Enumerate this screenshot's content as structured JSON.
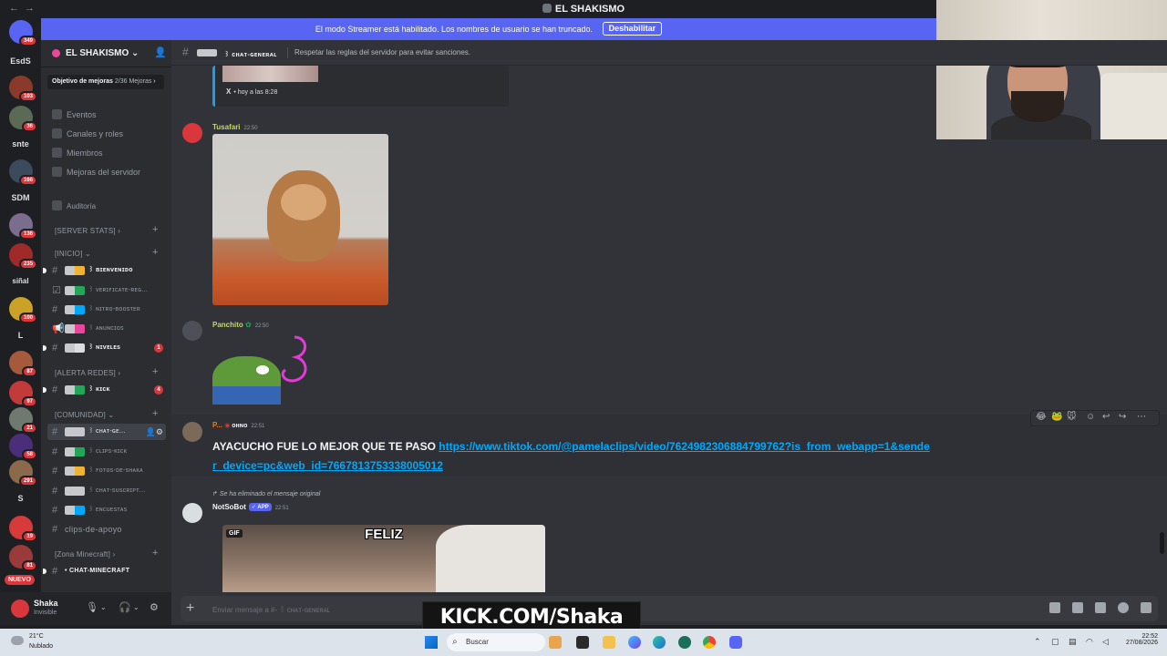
{
  "window": {
    "title": "EL SHAKISMO",
    "back": "←",
    "forward": "→"
  },
  "banner": {
    "text": "El modo Streamer está habilitado. Los nombres de usuario se han truncado.",
    "button": "Deshabilitar",
    "color": "#5865f2"
  },
  "rail": {
    "home_badge": "349",
    "servers": [
      {
        "label": "EsdS"
      },
      {
        "badge": "103"
      },
      {
        "badge": "36"
      },
      {
        "label": "snte"
      },
      {
        "badge": "166"
      },
      {
        "label": "SDM"
      },
      {
        "badge": "136"
      },
      {
        "badge": "235"
      },
      {
        "label": "siñal"
      },
      {
        "badge": "100"
      },
      {
        "label": "L"
      },
      {
        "badge": "87"
      },
      {
        "badge": "97"
      },
      {
        "badge": "21"
      },
      {
        "badge": "58"
      },
      {
        "badge": "291"
      },
      {
        "label": "S"
      },
      {
        "badge": "19"
      },
      {
        "badge": "81"
      }
    ],
    "nuevo": "NUEVO"
  },
  "server": {
    "name": "EL SHAKISMO",
    "boost_label": "Objetivo de mejoras",
    "boost_progress": "2/36 Mejoras",
    "links": [
      "Eventos",
      "Canales y roles",
      "Miembros",
      "Mejoras del servidor"
    ],
    "audit": "Auditoría"
  },
  "categories": {
    "server_stats": "[SERVER STATS]",
    "inicio": "[INICIO]",
    "alerta_redes": "[ALERTA REDES]",
    "comunidad": "[COMUNIDAD]",
    "zona_minecraft": "[Zona Minecraft]"
  },
  "channels": {
    "bienvenido": "꒱ ʙɪᴇɴᴠᴇɴɪᴅᴏ",
    "verificate": "꒱ ᴠᴇʀɪꜰɪᴄᴀᴛᴇ-ʀᴇɢ...",
    "nitro": "꒱ ɴɪᴛʀᴏ-ʙᴏᴏsᴛᴇʀ",
    "anuncios": "꒱ ᴀɴᴜɴᴄɪᴏs",
    "niveles": "꒱ ɴɪᴠᴇʟᴇs",
    "niveles_count": "1",
    "kick": "꒱ ᴋɪᴄᴋ",
    "kick_count": "4",
    "chat_general": "꒱ ᴄʜᴀᴛ-ɢᴇ...",
    "clips_kick": "꒱ ᴄʟɪᴘs-ᴋɪᴄᴋ",
    "fotos": "꒱ ꜰᴏᴛᴏs-ᴅᴇ-sʜᴀᴋᴀ",
    "chat_suscript": "꒱ ᴄʜᴀᴛ-sᴜsᴄʀɪᴘᴛ...",
    "encuestas": "꒱ ᴇɴᴄᴜᴇsᴛᴀs",
    "clips_apoyo": "clips-de-apoyo",
    "chat_minecraft": "• CHAT-MINECRAFT"
  },
  "user": {
    "name": "Shaka",
    "status": "Invisible"
  },
  "chat": {
    "channel": "꒱ ᴄʜᴀᴛ-ɢᴇɴᴇʀᴀʟ",
    "topic": "Respetar las reglas del servidor para evitar sanciones.",
    "embed_source": "X",
    "embed_time": "hoy a las 8:28",
    "messages": [
      {
        "author": "Tusafari",
        "time": "22:50",
        "color": "#c5d86d"
      },
      {
        "author": "Panchito",
        "time": "22:50",
        "color": "#c5d86d"
      },
      {
        "author": "P...",
        "role": "ᴏʜɴᴏ",
        "time": "22:51",
        "color": "#e67e22",
        "text": "AYACUCHO FUE LO MEJOR QUE TE PASO",
        "link": "https://www.tiktok.com/@pamelaclips/video/7624982306884799762?is_from_webapp=1&sender_device=pc&web_id=7667813753338005012"
      },
      {
        "author": "NotSoBot",
        "tag": "✓ APP",
        "time": "22:51",
        "color": "#f2f3f5",
        "reply": "Se ha eliminado el mensaje original",
        "gif_badge": "GIF",
        "gif_caption": "FELIZ"
      }
    ],
    "composer_placeholder": "Enviar mensaje a #-",
    "composer_channel": "꒱ ᴄʜᴀᴛ-ɢᴇɴᴇʀᴀʟ"
  },
  "overlay": {
    "kick": "KICK.COM/Shaka"
  },
  "taskbar": {
    "temp": "21°C",
    "condition": "Nublado",
    "search": "Buscar",
    "time": "22:52",
    "date": "27/08/2026"
  }
}
